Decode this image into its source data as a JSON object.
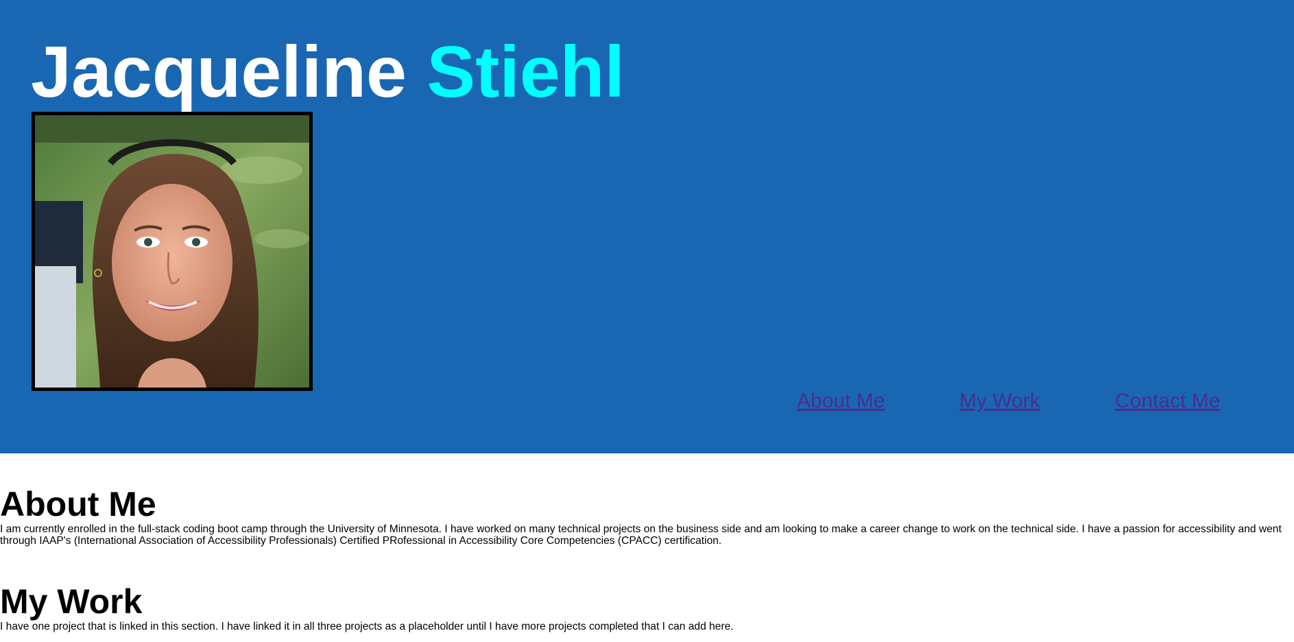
{
  "header": {
    "first_name": "Jacqueline",
    "last_name": "Stiehl",
    "portrait_alt": "Photo of Jacqueline Stiehl",
    "background_color": "#1967b3",
    "last_name_color": "#00ffff"
  },
  "nav": {
    "items": [
      {
        "label": "About Me"
      },
      {
        "label": "My Work"
      },
      {
        "label": "Contact Me"
      }
    ],
    "link_color": "#4b2c8f"
  },
  "about": {
    "heading": "About Me",
    "text": "I am currently enrolled in the full-stack coding boot camp through the University of Minnesota. I have worked on many technical projects on the business side and am looking to make a career change to work on the technical side. I have a passion for accessibility and went through IAAP's (International Association of Accessibility Professionals) Certified PRofessional in Accessibility Core Competencies (CPACC) certification."
  },
  "work": {
    "heading": "My Work",
    "text": "I have one project that is linked in this section. I have linked it in all three projects as a placeholder until I have more projects completed that I can add here."
  }
}
